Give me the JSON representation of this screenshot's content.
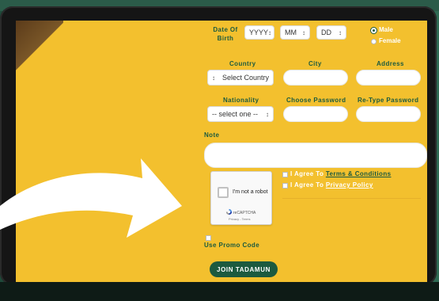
{
  "form": {
    "dob_label": "Date Of\nBirth",
    "dob_year": "YYYY",
    "dob_month": "MM",
    "dob_day": "DD",
    "gender": {
      "male": "Male",
      "female": "Female",
      "selected": "Male"
    },
    "country_label": "Country",
    "country_value": "Select Country",
    "city_label": "City",
    "address_label": "Address",
    "nationality_label": "Nationality",
    "nationality_value": "-- select one --",
    "password_label": "Choose Password",
    "retype_label": "Re-Type Password",
    "note_label": "Note",
    "captcha_text": "I'm not a robot",
    "captcha_brand": "reCAPTCHA",
    "captcha_terms": "Privacy - Terms",
    "agree_prefix": "I Agree To",
    "terms_link": "Terms & Conditions",
    "privacy_link": "Privacy Policy",
    "promo_label": "Use Promo Code",
    "join_button": "JOIN TADAMUN"
  },
  "colors": {
    "screen_bg": "#f3c02e",
    "brand_green": "#1c5a3f",
    "frame": "#151515"
  },
  "icons": [
    "arrow-icon",
    "recaptcha-logo-icon",
    "caret-icon"
  ]
}
